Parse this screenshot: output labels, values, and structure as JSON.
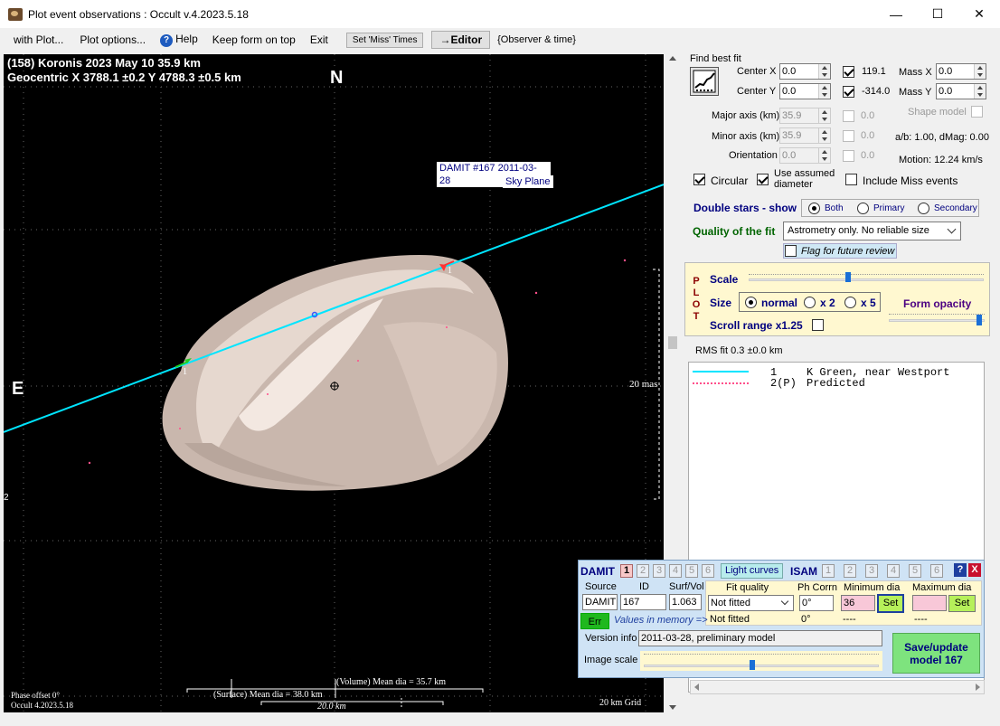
{
  "window": {
    "title": "Plot event observations : Occult v.4.2023.5.18",
    "min": "—",
    "max": "☐",
    "close": "✕"
  },
  "menu": {
    "with_plot": "with Plot...",
    "plot_options": "Plot options...",
    "help": "Help",
    "keep_on_top": "Keep form on top",
    "exit": "Exit",
    "set_miss": "Set 'Miss' Times",
    "editor": "→Editor",
    "observer_time": "{Observer & time}"
  },
  "plot": {
    "title_line1": "(158) Koronis  2023 May 10   35.9 km",
    "title_line2": "Geocentric  X  3788.1 ±0.2  Y 4788.3 ±0.5 km",
    "north": "N",
    "east": "E",
    "damit_label1": "DAMIT #167 2011-03-28",
    "damit_label2": "Sky Plane",
    "scale_label": "20 mas",
    "chord_1a": "1",
    "chord_1b": "1",
    "phase_offset": "Phase offset 0°",
    "version": "Occult 4.2023.5.18",
    "volume_dia": "(Volume) Mean dia = 35.7 km",
    "surface_dia": "(Surface) Mean dia = 38.0 km",
    "km_scale": "20.0 km",
    "grid": "20 km Grid",
    "left_edge": "2"
  },
  "fit": {
    "find_best_fit": "Find best fit",
    "center_x_label": "Center X",
    "center_x": "0.0",
    "center_x_val": "119.1",
    "center_y_label": "Center Y",
    "center_y": "0.0",
    "center_y_val": "-314.0",
    "mass_x_label": "Mass X",
    "mass_x": "0.0",
    "mass_y_label": "Mass Y",
    "mass_y": "0.0",
    "major_label": "Major axis (km)",
    "major": "35.9",
    "major_val": "0.0",
    "minor_label": "Minor axis (km)",
    "minor": "35.9",
    "minor_val": "0.0",
    "orient_label": "Orientation",
    "orient": "0.0",
    "orient_val": "0.0",
    "shape_model": "Shape model",
    "ab_dmag": "a/b: 1.00, dMag: 0.00",
    "motion": "Motion: 12.24 km/s",
    "circular": "Circular",
    "use_assumed1": "Use assumed",
    "use_assumed2": "diameter",
    "include_miss": "Include Miss events",
    "double_stars": "Double stars - show",
    "both": "Both",
    "primary": "Primary",
    "secondary": "Secondary",
    "quality_label": "Quality of the fit",
    "quality_value": "Astrometry only. No reliable size",
    "flag_review": "Flag for future review"
  },
  "plotpanel": {
    "plot_letters": [
      "P",
      "L",
      "O",
      "T"
    ],
    "scale": "Scale",
    "size": "Size",
    "normal": "normal",
    "x2": "x 2",
    "x5": "x 5",
    "form_opacity": "Form opacity",
    "scroll_range": "Scroll range x1.25",
    "scale_level": 0.42,
    "opacity_level": 0.97
  },
  "rms": "RMS fit 0.3 ±0.0 km",
  "legend": [
    {
      "num": "1",
      "text": "K Green, near Westport",
      "color": "#00e5ff"
    },
    {
      "num": "2(P)",
      "text": "Predicted",
      "color": "#ff4f8b"
    }
  ],
  "damit": {
    "title": "DAMIT",
    "tabs": [
      "1",
      "2",
      "3",
      "4",
      "5",
      "6"
    ],
    "light_curves": "Light curves",
    "isam": "ISAM",
    "isam_tabs": [
      "1",
      "2",
      "3",
      "4",
      "5",
      "6"
    ],
    "help": "?",
    "close": "X",
    "source_label": "Source",
    "id_label": "ID",
    "surf_label": "Surf/Vol",
    "fit_quality_label": "Fit quality",
    "ph_corr_label": "Ph Corrn",
    "min_dia_label": "Minimum dia",
    "max_dia_label": "Maximum dia",
    "source": "DAMIT",
    "id": "167",
    "surf": "1.063",
    "fit_quality": "Not fitted",
    "ph_corr": "0°",
    "min_dia": "36",
    "set1": "Set",
    "max_dia": "",
    "set2": "Set",
    "err": "Err",
    "values_in_memory": "Values in memory =>",
    "mem_fit": "Not fitted",
    "mem_ph": "0°",
    "mem_min": "----",
    "mem_max": "----",
    "version_label": "Version info",
    "version": "2011-03-28, preliminary model",
    "image_scale": "Image scale",
    "image_scale_level": 0.47,
    "save1": "Save/update",
    "save2": "model 167"
  },
  "colors": {
    "chord": "#00e5ff",
    "predicted": "#ff4f8b",
    "dark_blue": "#00007f",
    "green_title": "#006400",
    "save_btn": "#7ee37e",
    "damit_bg": "#cfe3f5"
  }
}
